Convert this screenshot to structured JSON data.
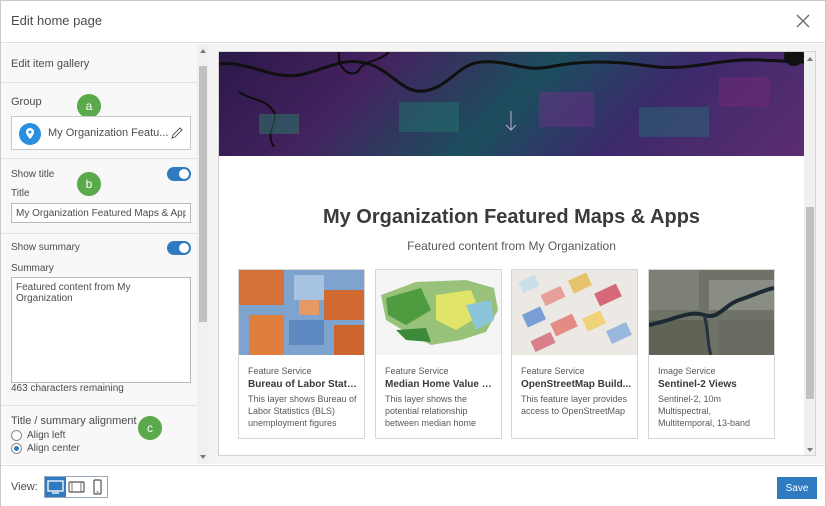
{
  "dialog": {
    "title": "Edit home page"
  },
  "panel": {
    "section_title": "Edit item gallery",
    "group_label": "Group",
    "group_name": "My Organization Featu...",
    "show_title_label": "Show title",
    "title_label": "Title",
    "title_value": "My Organization Featured Maps & Apps",
    "show_summary_label": "Show summary",
    "summary_label": "Summary",
    "summary_value": "Featured content from My Organization",
    "chars_remaining": "463 characters remaining",
    "alignment_label": "Title / summary alignment",
    "align_left": "Align left",
    "align_center": "Align center",
    "selected_alignment": "center"
  },
  "badges": {
    "a": "a",
    "b": "b",
    "c": "c"
  },
  "preview": {
    "title": "My Organization Featured Maps & Apps",
    "subtitle": "Featured content from My Organization",
    "cards": [
      {
        "type": "Feature Service",
        "name": "Bureau of Labor Statis...",
        "desc": "This layer shows Bureau of Labor Statistics (BLS) unemployment figures"
      },
      {
        "type": "Feature Service",
        "name": "Median Home Value a...",
        "desc": "This layer shows the potential relationship between median home"
      },
      {
        "type": "Feature Service",
        "name": "OpenStreetMap Build...",
        "desc": "This feature layer provides access to OpenStreetMap"
      },
      {
        "type": "Image Service",
        "name": "Sentinel-2 Views",
        "desc": "Sentinel-2, 10m Multispectral, Multitemporal, 13-band"
      }
    ]
  },
  "footer": {
    "view_label": "View:",
    "save_label": "Save"
  },
  "colors": {
    "accent": "#2f7bc2",
    "badge": "#5aa94a"
  }
}
